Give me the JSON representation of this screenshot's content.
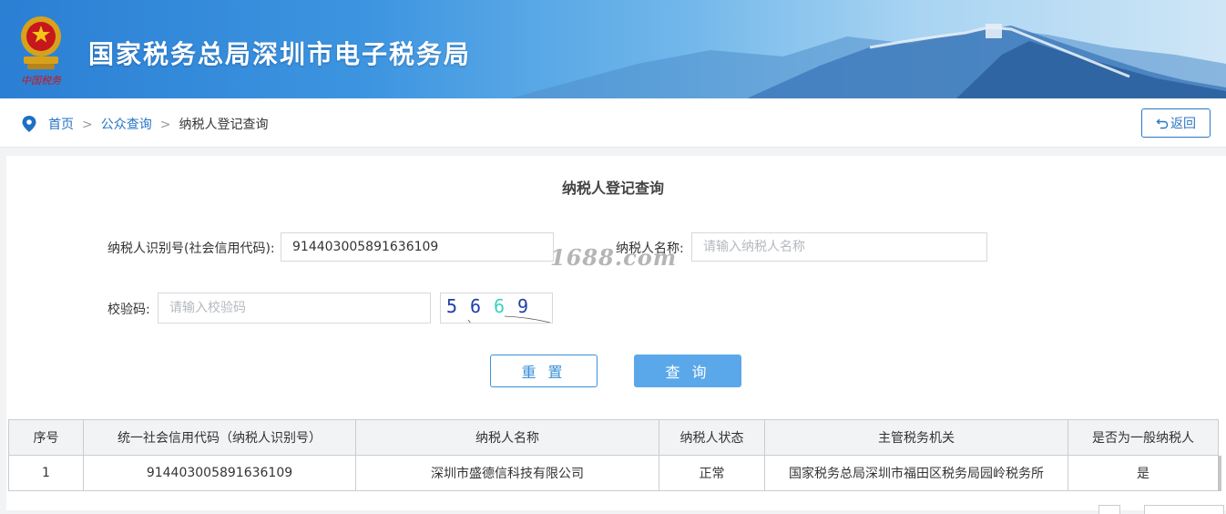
{
  "header": {
    "title": "国家税务总局深圳市电子税务局",
    "emblem_caption": "中国税务"
  },
  "breadcrumb": {
    "home": "首页",
    "public_query": "公众查询",
    "current": "纳税人登记查询",
    "separator": ">"
  },
  "back_button": {
    "label": "返回"
  },
  "form": {
    "title": "纳税人登记查询",
    "taxpayer_id_label": "纳税人识别号(社会信用代码):",
    "taxpayer_id_value": "914403005891636109",
    "taxpayer_name_label": "纳税人名称:",
    "taxpayer_name_placeholder": "请输入纳税人名称",
    "captcha_label": "校验码:",
    "captcha_placeholder": "请输入校验码",
    "captcha_digits": [
      "5",
      "6",
      "6",
      "9"
    ],
    "reset_label": "重 置",
    "query_label": "查 询"
  },
  "watermark": "1688.com",
  "table": {
    "headers": [
      "序号",
      "统一社会信用代码（纳税人识别号）",
      "纳税人名称",
      "纳税人状态",
      "主管税务机关",
      "是否为一般纳税人"
    ],
    "rows": [
      [
        "1",
        "914403005891636109",
        "深圳市盛德信科技有限公司",
        "正常",
        "国家税务总局深圳市福田区税务局园岭税务所",
        "是"
      ]
    ]
  },
  "colors": {
    "accent": "#2a76c6",
    "query_button": "#5aa8ea",
    "captcha_digit_1": "#1f3fa8",
    "captcha_digit_2": "#1f3fa8",
    "captcha_digit_3": "#3fd0c0",
    "captcha_digit_4": "#1f3fa8"
  }
}
